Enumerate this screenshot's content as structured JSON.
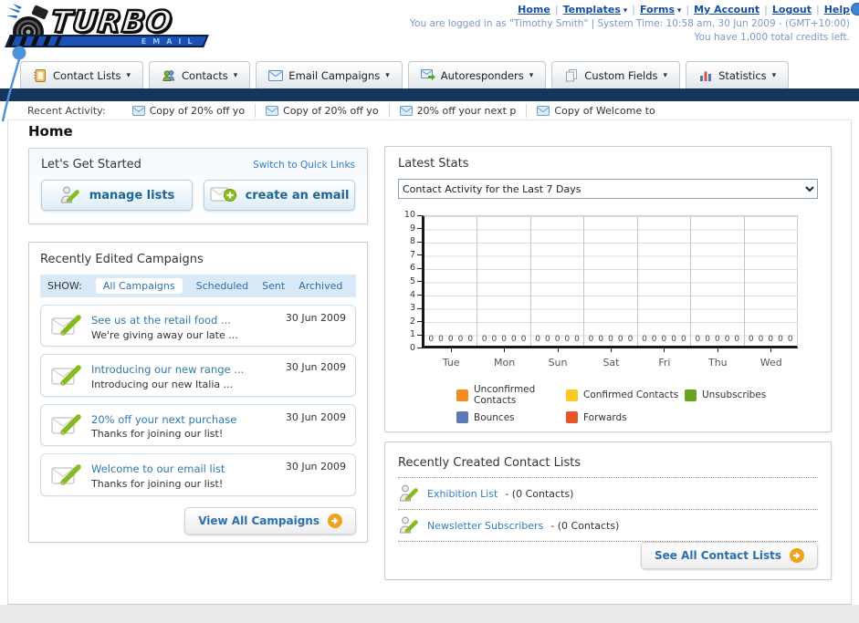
{
  "header": {
    "nav_links": [
      {
        "label": "Home",
        "caret": false
      },
      {
        "label": "Templates",
        "caret": true
      },
      {
        "label": "Forms",
        "caret": true
      },
      {
        "label": "My Account",
        "caret": false
      },
      {
        "label": "Logout",
        "caret": false
      },
      {
        "label": "Help",
        "caret": false
      }
    ],
    "login_line": "You are logged in as \"Timothy Smith\" | System Time: 10:58 am, 30 Jun 2009 - (GMT+10:00)",
    "credits_line": "You have 1,000 total credits left.",
    "logo_title": "TURBO",
    "logo_subtitle": "EMAIL"
  },
  "tabs": [
    {
      "label": "Contact Lists",
      "icon": "address-book-icon"
    },
    {
      "label": "Contacts",
      "icon": "contacts-icon"
    },
    {
      "label": "Email Campaigns",
      "icon": "envelope-icon"
    },
    {
      "label": "Autoresponders",
      "icon": "autoresponder-icon"
    },
    {
      "label": "Custom Fields",
      "icon": "custom-fields-icon"
    },
    {
      "label": "Statistics",
      "icon": "statistics-icon"
    }
  ],
  "recent_activity": {
    "label": "Recent Activity:",
    "items": [
      "Copy of 20% off yo",
      "Copy of 20% off yo",
      "20% off your next p",
      "Copy of Welcome to"
    ]
  },
  "page": {
    "title": "Home"
  },
  "get_started": {
    "title": "Let's Get Started",
    "switch_link": "Switch to Quick Links",
    "buttons": [
      {
        "label": "manage lists",
        "icon": "person-pencil-icon"
      },
      {
        "label": "create an email",
        "icon": "envelope-plus-icon"
      }
    ]
  },
  "campaigns": {
    "title": "Recently Edited Campaigns",
    "show_label": "SHOW:",
    "filters": [
      "All Campaigns",
      "Scheduled",
      "Sent",
      "Archived"
    ],
    "active_filter": "All Campaigns",
    "items": [
      {
        "title": "See us at the retail food ...",
        "subtitle": "We're giving away our late ...",
        "date": "30 Jun 2009"
      },
      {
        "title": "Introducing our new range ...",
        "subtitle": "Introducing our new Italia ...",
        "date": "30 Jun 2009"
      },
      {
        "title": "20% off your next purchase",
        "subtitle": "Thanks for joining our list!",
        "date": "30 Jun 2009"
      },
      {
        "title": "Welcome to our email list",
        "subtitle": "Thanks for joining our list!",
        "date": "30 Jun 2009"
      }
    ],
    "view_all_label": "View All Campaigns"
  },
  "stats": {
    "title": "Latest Stats",
    "dropdown_value": "Contact Activity for the Last 7 Days"
  },
  "chart_data": {
    "type": "bar",
    "title": "Contact Activity for the Last 7 Days",
    "categories": [
      "Tue",
      "Mon",
      "Sun",
      "Sat",
      "Fri",
      "Thu",
      "Wed"
    ],
    "series": [
      {
        "name": "Unconfirmed Contacts",
        "color": "#f08a21",
        "values": [
          0,
          0,
          0,
          0,
          0,
          0,
          0
        ]
      },
      {
        "name": "Confirmed Contacts",
        "color": "#fcc822",
        "values": [
          0,
          0,
          0,
          0,
          0,
          0,
          0
        ]
      },
      {
        "name": "Unsubscribes",
        "color": "#68a41d",
        "values": [
          0,
          0,
          0,
          0,
          0,
          0,
          0
        ]
      },
      {
        "name": "Bounces",
        "color": "#5b79b3",
        "values": [
          0,
          0,
          0,
          0,
          0,
          0,
          0
        ]
      },
      {
        "name": "Forwards",
        "color": "#e8542a",
        "values": [
          0,
          0,
          0,
          0,
          0,
          0,
          0
        ]
      }
    ],
    "xlabel": "",
    "ylabel": "",
    "ylim": [
      0,
      10
    ],
    "ytick_step": 1,
    "grid": "horizontal-and-day-separators",
    "legend_position": "bottom",
    "data_labels": "all values shown as 0 above baseline"
  },
  "contact_lists": {
    "title": "Recently Created Contact Lists",
    "items": [
      {
        "name": "Exhibition List",
        "detail": "- (0 Contacts)"
      },
      {
        "name": "Newsletter Subscribers",
        "detail": "- (0 Contacts)"
      }
    ],
    "see_all_label": "See All Contact Lists"
  },
  "colors": {
    "navy_bar": "#14355e",
    "link_blue": "#2a6fae",
    "header_link": "#17519c",
    "button_text": "#1d6593",
    "orange_arrow": "#f1a11b",
    "filter_bar_bg": "#d9e9f8"
  }
}
